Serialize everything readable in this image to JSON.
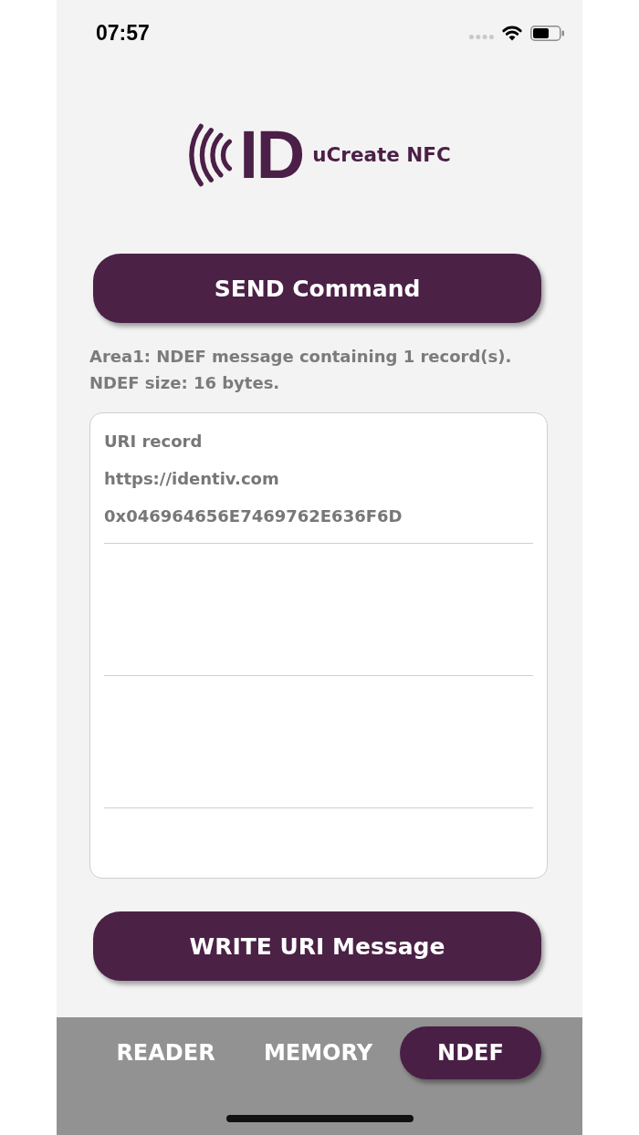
{
  "status_bar": {
    "time": "07:57"
  },
  "logo": {
    "mark": "ID",
    "name": "uCreate NFC"
  },
  "send_button": {
    "label": "SEND Command"
  },
  "info": [
    "Area1: NDEF message containing 1 record(s).",
    "NDEF size: 16 bytes."
  ],
  "records": [
    {
      "type": "URI record",
      "uri": "https://identiv.com",
      "payload_hex": "0x046964656E7469762E636F6D"
    }
  ],
  "write_button": {
    "label": "WRITE URI Message"
  },
  "tabs": [
    {
      "label": "READER",
      "selected": false
    },
    {
      "label": "MEMORY",
      "selected": false
    },
    {
      "label": "NDEF",
      "selected": true
    }
  ]
}
